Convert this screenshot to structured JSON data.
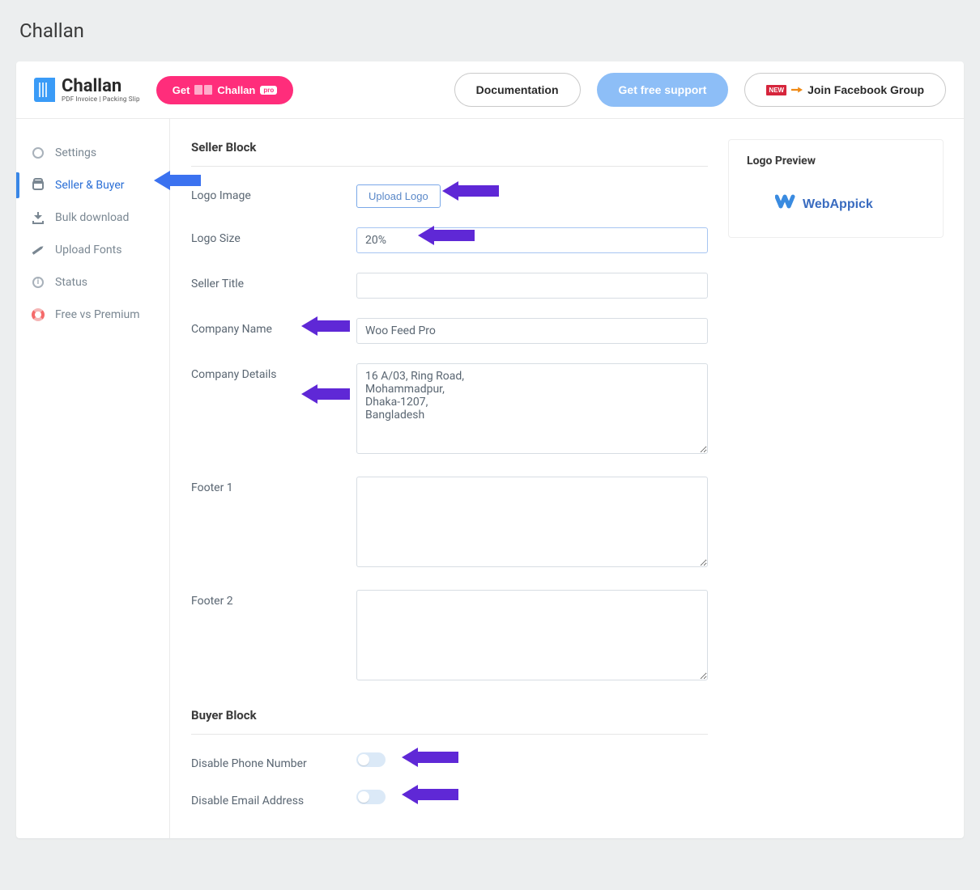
{
  "page_title": "Challan",
  "brand": {
    "name": "Challan",
    "subtitle": "PDF Invoice | Packing Slip"
  },
  "topbar": {
    "get_btn_prefix": "Get",
    "get_btn_name": "Challan",
    "get_btn_badge": "pro",
    "doc_label": "Documentation",
    "support_label": "Get free support",
    "fb_label": "Join Facebook Group",
    "new_badge": "NEW"
  },
  "sidebar": {
    "items": [
      {
        "label": "Settings"
      },
      {
        "label": "Seller & Buyer"
      },
      {
        "label": "Bulk download"
      },
      {
        "label": "Upload Fonts"
      },
      {
        "label": "Status"
      },
      {
        "label": "Free vs Premium"
      }
    ]
  },
  "seller": {
    "section_title": "Seller Block",
    "logo_image_label": "Logo Image",
    "upload_logo_btn": "Upload Logo",
    "logo_size_label": "Logo Size",
    "logo_size_value": "20%",
    "seller_title_label": "Seller Title",
    "seller_title_value": "",
    "company_name_label": "Company Name",
    "company_name_value": "Woo Feed Pro",
    "company_details_label": "Company Details",
    "company_details_value": "16 A/03, Ring Road,\nMohammadpur,\nDhaka-1207,\nBangladesh",
    "footer1_label": "Footer 1",
    "footer1_value": "",
    "footer2_label": "Footer 2",
    "footer2_value": ""
  },
  "buyer": {
    "section_title": "Buyer Block",
    "disable_phone_label": "Disable Phone Number",
    "disable_email_label": "Disable Email Address"
  },
  "preview": {
    "title": "Logo Preview",
    "logo_text": "WebAppick"
  }
}
